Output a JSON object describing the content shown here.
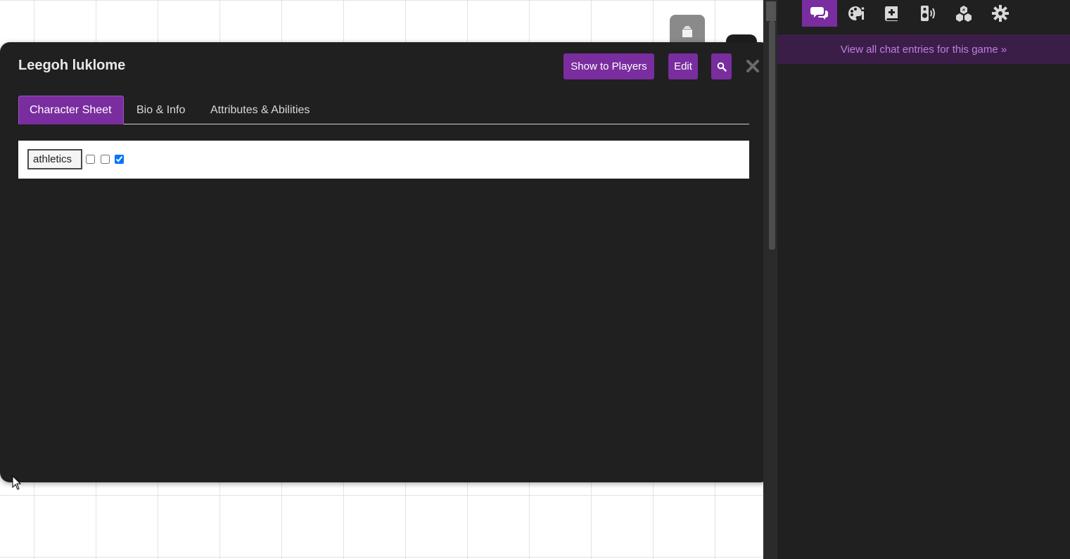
{
  "dialog": {
    "title": "Leegoh luklome",
    "buttons": {
      "show_to_players": "Show to Players",
      "edit": "Edit"
    },
    "tabs": [
      {
        "label": "Character Sheet",
        "active": true
      },
      {
        "label": "Bio & Info",
        "active": false
      },
      {
        "label": "Attributes & Abilities",
        "active": false
      }
    ],
    "sheet": {
      "skill_value": "athletics",
      "checkboxes": [
        false,
        false,
        true
      ]
    }
  },
  "sidebar": {
    "tabs": [
      {
        "icon": "chat-icon",
        "active": true
      },
      {
        "icon": "art-library-icon",
        "active": false
      },
      {
        "icon": "journal-icon",
        "active": false
      },
      {
        "icon": "jukebox-icon",
        "active": false
      },
      {
        "icon": "collections-icon",
        "active": false
      },
      {
        "icon": "settings-icon",
        "active": false
      }
    ],
    "chat_link": "View all chat entries for this game »"
  },
  "colors": {
    "accent": "#7a2d9f",
    "panel": "#202020",
    "chat_banner": "#3a1e48",
    "chat_link": "#c07fe0"
  }
}
